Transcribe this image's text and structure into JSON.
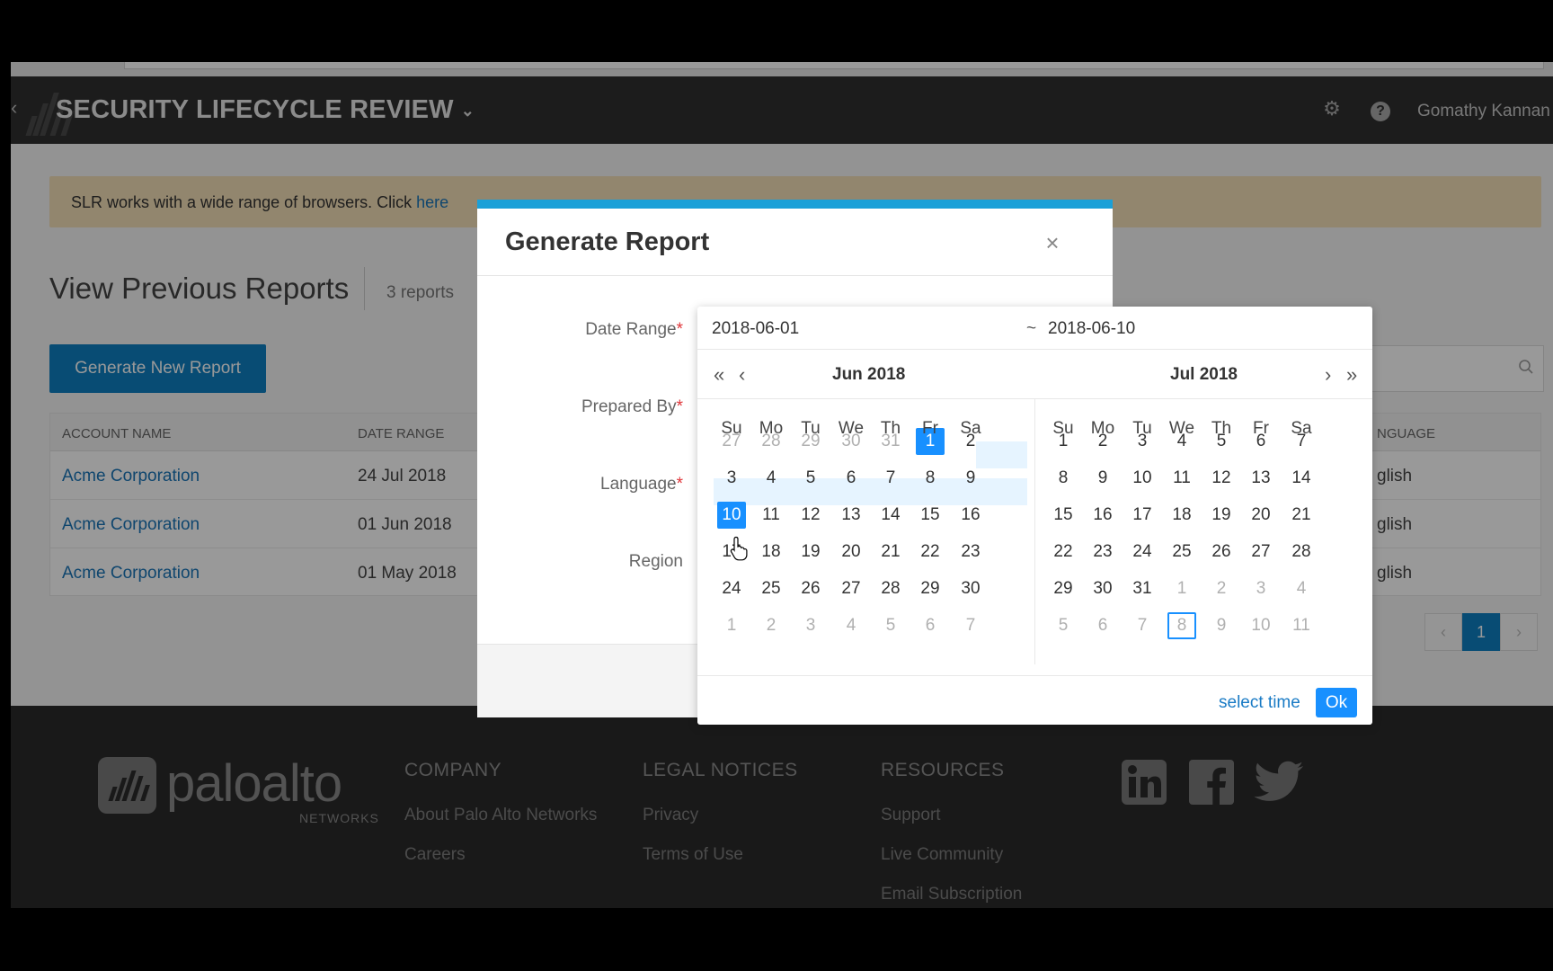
{
  "header": {
    "title": "SECURITY LIFECYCLE REVIEW",
    "user": "Gomathy Kannan"
  },
  "notice": {
    "text": "SLR works with a wide range of browsers. Click ",
    "link": "here"
  },
  "reports": {
    "title": "View Previous Reports",
    "count": "3 reports",
    "generate_button": "Generate New Report",
    "columns": [
      "ACCOUNT NAME",
      "DATE RANGE",
      "NGUAGE"
    ],
    "rows": [
      {
        "account": "Acme Corporation",
        "date_range": "24 Jul 2018",
        "language": "glish"
      },
      {
        "account": "Acme Corporation",
        "date_range": "01 Jun 2018",
        "language": "glish"
      },
      {
        "account": "Acme Corporation",
        "date_range": "01 May 2018",
        "language": "glish"
      }
    ],
    "pager": {
      "prev": "‹",
      "page": "1",
      "next": "›"
    }
  },
  "footer": {
    "brand": "paloalto",
    "brand_sub": "NETWORKS",
    "columns": [
      {
        "heading": "COMPANY",
        "links": [
          "About Palo Alto Networks",
          "Careers"
        ]
      },
      {
        "heading": "LEGAL NOTICES",
        "links": [
          "Privacy",
          "Terms of Use"
        ]
      },
      {
        "heading": "RESOURCES",
        "links": [
          "Support",
          "Live Community",
          "Email Subscription"
        ]
      }
    ]
  },
  "modal": {
    "title": "Generate Report",
    "close": "×",
    "fields": [
      {
        "label": "Date Range",
        "required": "*"
      },
      {
        "label": "Prepared By",
        "required": "*"
      },
      {
        "label": "Language",
        "required": "*"
      },
      {
        "label": "Region",
        "required": ""
      }
    ]
  },
  "datepicker": {
    "start_value": "2018-06-01",
    "separator": "~",
    "end_value": "2018-06-10",
    "nav": {
      "prev_year": "«",
      "prev_month": "‹",
      "next_month": "›",
      "next_year": "»"
    },
    "weekdays": [
      "Su",
      "Mo",
      "Tu",
      "We",
      "Th",
      "Fr",
      "Sa"
    ],
    "left": {
      "title": "Jun 2018",
      "weeks": [
        [
          "27",
          "28",
          "29",
          "30",
          "31",
          "1",
          "2"
        ],
        [
          "3",
          "4",
          "5",
          "6",
          "7",
          "8",
          "9"
        ],
        [
          "10",
          "11",
          "12",
          "13",
          "14",
          "15",
          "16"
        ],
        [
          "17",
          "18",
          "19",
          "20",
          "21",
          "22",
          "23"
        ],
        [
          "24",
          "25",
          "26",
          "27",
          "28",
          "29",
          "30"
        ],
        [
          "1",
          "2",
          "3",
          "4",
          "5",
          "6",
          "7"
        ]
      ]
    },
    "right": {
      "title": "Jul 2018",
      "weeks": [
        [
          "1",
          "2",
          "3",
          "4",
          "5",
          "6",
          "7"
        ],
        [
          "8",
          "9",
          "10",
          "11",
          "12",
          "13",
          "14"
        ],
        [
          "15",
          "16",
          "17",
          "18",
          "19",
          "20",
          "21"
        ],
        [
          "22",
          "23",
          "24",
          "25",
          "26",
          "27",
          "28"
        ],
        [
          "29",
          "30",
          "31",
          "1",
          "2",
          "3",
          "4"
        ],
        [
          "5",
          "6",
          "7",
          "8",
          "9",
          "10",
          "11"
        ]
      ]
    },
    "range_start": "Jun 1 2018",
    "range_end": "Jun 10 2018",
    "today": "Aug 8 2018",
    "select_time": "select time",
    "ok": "Ok",
    "accent": "#1890ff",
    "range_fill": "#e6f4ff"
  }
}
